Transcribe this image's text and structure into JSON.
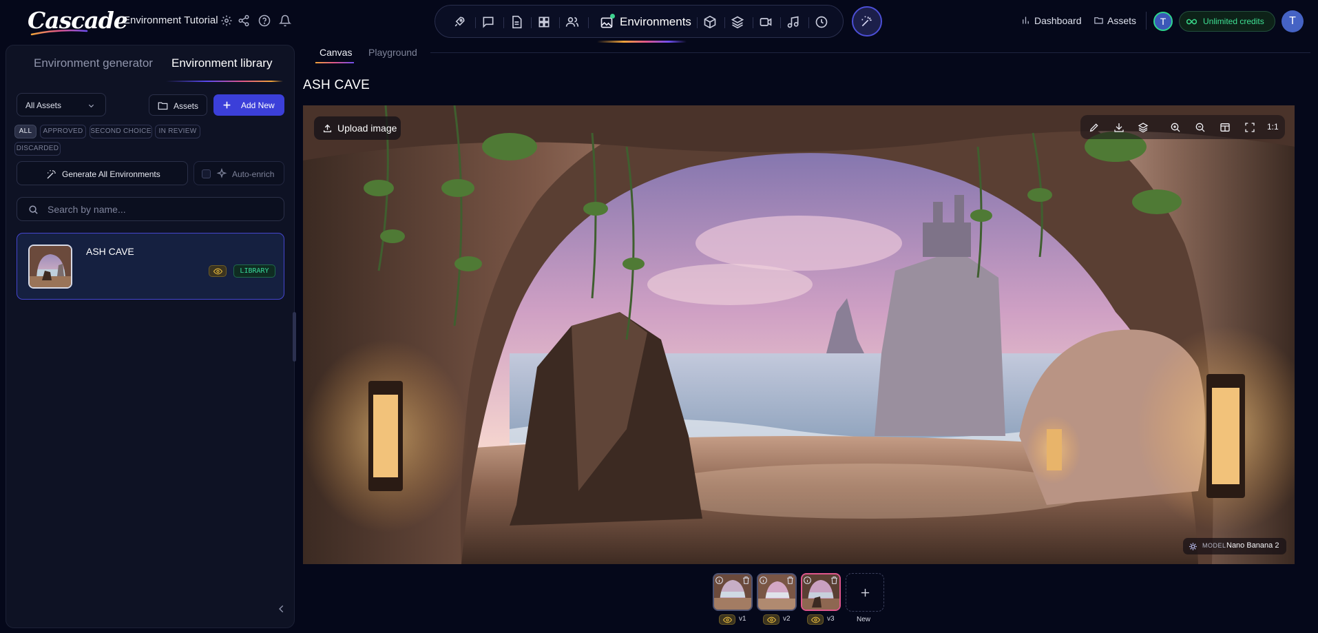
{
  "app": {
    "logo_text": "Cascade",
    "project_title": "Environment Tutorial"
  },
  "header": {
    "active_section": "Environments",
    "sections": [
      "rocket",
      "chat",
      "document",
      "grid",
      "characters",
      "environments",
      "cube",
      "layers",
      "video",
      "music",
      "clock"
    ],
    "links": {
      "dashboard": "Dashboard",
      "assets": "Assets"
    },
    "avatar_initial": "T",
    "credits_label": "Unlimited credits"
  },
  "left_panel": {
    "tabs": {
      "generator": "Environment generator",
      "library": "Environment library"
    },
    "active_tab": "Environment library",
    "filter_select": "All Assets",
    "assets_button": "Assets",
    "add_new_button": "Add New",
    "status_chips": [
      "ALL",
      "APPROVED",
      "SECOND CHOICE",
      "IN REVIEW",
      "DISCARDED"
    ],
    "active_chip": "ALL",
    "generate_all_button": "Generate All Environments",
    "auto_enrich_label": "Auto-enrich",
    "search_placeholder": "Search by name...",
    "environments": [
      {
        "name": "ASH CAVE",
        "badge": "LIBRARY",
        "selected": true
      }
    ]
  },
  "main": {
    "tabs": {
      "canvas": "Canvas",
      "playground": "Playground"
    },
    "active_tab": "Canvas",
    "title": "ASH CAVE",
    "upload_button": "Upload image",
    "toolbar_ratio": "1:1",
    "model_label": "MODEL",
    "model_value": "Nano Banana 2",
    "versions": [
      {
        "label": "v1",
        "active": false
      },
      {
        "label": "v2",
        "active": false
      },
      {
        "label": "v3",
        "active": true
      }
    ],
    "new_version_label": "New"
  },
  "colors": {
    "background": "#05081a",
    "accent_blue": "#3b3fd9",
    "accent_green": "#38d99a",
    "accent_pink": "#e0568c",
    "accent_orange": "#f0a33a"
  }
}
